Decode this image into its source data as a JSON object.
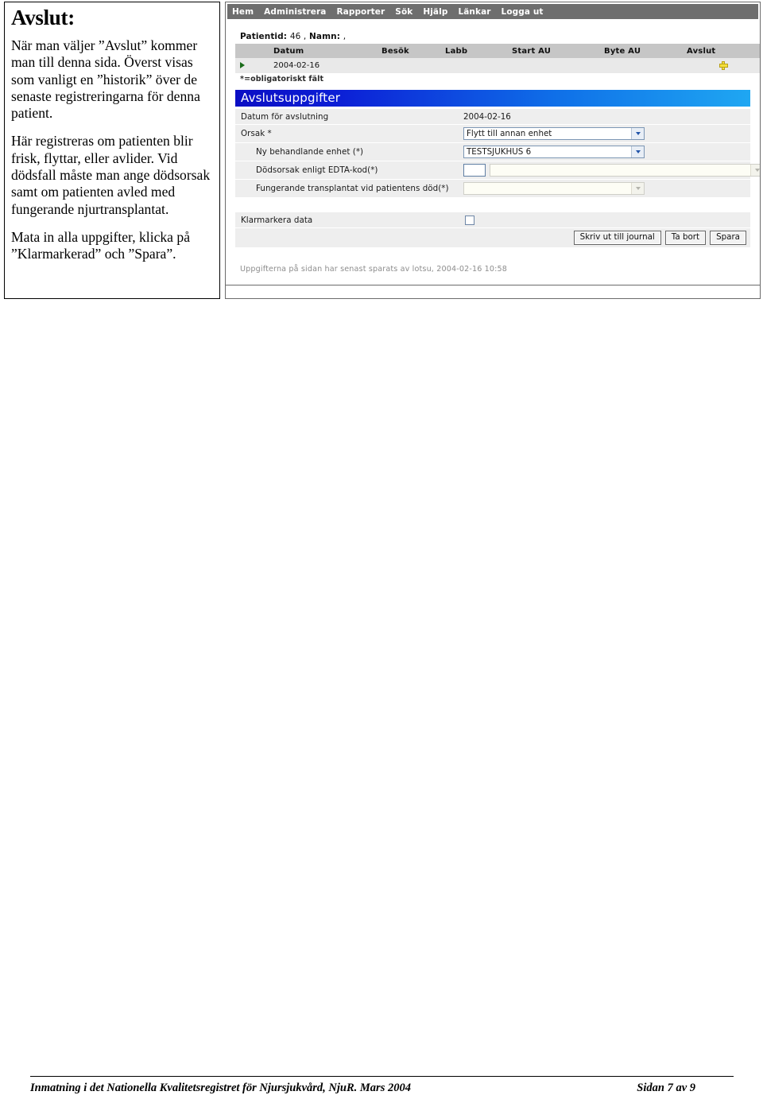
{
  "note": {
    "title": "Avslut:",
    "paragraphs": [
      "När man väljer ”Avslut” kommer man till denna sida. Överst visas som vanligt en ”historik” över de senaste registreringarna för denna patient.",
      "Här registreras om patienten blir frisk, flyttar, eller avlider.\nVid dödsfall måste man ange dödsorsak samt om patienten avled med fungerande njurtransplantat.",
      "Mata in alla uppgifter, klicka på ”Klarmarkerad” och ”Spara”."
    ],
    "para1": "När man väljer ”Avslut” kommer man till denna sida. Överst visas som vanligt en ”historik” över de senaste registreringarna för denna patient.",
    "para2": "Här registreras om patienten blir frisk, flyttar, eller avlider. Vid dödsfall måste man ange dödsorsak samt om patienten avled med fungerande njurtransplantat.",
    "para3": "Mata in alla uppgifter, klicka på ”Klarmarkerad” och ”Spara”."
  },
  "screenshot": {
    "menubar": {
      "items": [
        {
          "label": "Hem"
        },
        {
          "label": "Administrera"
        },
        {
          "label": "Rapporter"
        },
        {
          "label": "Sök"
        },
        {
          "label": "Hjälp"
        },
        {
          "label": "Länkar"
        },
        {
          "label": "Logga ut"
        }
      ]
    },
    "patient": {
      "id_label": "Patientid:",
      "id_value": "46 ,",
      "name_label": "Namn:",
      "name_value": ","
    },
    "history_table": {
      "headers": [
        "",
        "Datum",
        "Besök",
        "Labb",
        "Start AU",
        "Byte AU",
        "Avslut"
      ],
      "rows": [
        {
          "arrow": "selected-row-arrow",
          "datum": "2004-02-16",
          "besok": "",
          "labb": "",
          "start_au": "",
          "byte_au": "",
          "avslut_icon": "plus-icon"
        }
      ]
    },
    "obligatory_note": "*=obligatoriskt fält",
    "section_title": "Avslutsuppgifter",
    "form": {
      "rows": [
        {
          "label": "Datum för avslutning",
          "value": "2004-02-16",
          "type": "text"
        },
        {
          "label": "Orsak *",
          "value": "Flytt till annan enhet",
          "type": "select",
          "enabled": true
        },
        {
          "label": "Ny behandlande enhet (*)",
          "value": "TESTSJUKHUS 6",
          "type": "select",
          "enabled": true,
          "indent": true
        },
        {
          "label": "Dödsorsak enligt EDTA-kod(*)",
          "value": "",
          "type": "code-select",
          "enabled": false,
          "indent": true
        },
        {
          "label": "Fungerande transplantat vid patientens död(*)",
          "value": "",
          "type": "select",
          "enabled": false,
          "indent": true
        }
      ],
      "datum_label": "Datum för avslutning",
      "datum_value": "2004-02-16",
      "orsak_label": "Orsak *",
      "orsak_value": "Flytt till annan enhet",
      "enhet_label": "Ny behandlande enhet (*)",
      "enhet_value": "TESTSJUKHUS 6",
      "edta_label": "Dödsorsak enligt EDTA-kod(*)",
      "edta_code_value": "",
      "edta_value": "",
      "transplantat_label": "Fungerande transplantat vid patientens död(*)",
      "transplantat_value": "",
      "klarmarkera_label": "Klarmarkera data",
      "klarmarkera_checked": false
    },
    "buttons": {
      "print": "Skriv ut till journal",
      "delete": "Ta bort",
      "save": "Spara"
    },
    "saved_note": "Uppgifterna på sidan har senast sparats av lotsu, 2004-02-16 10:58",
    "colors": {
      "menubar_bg": "#6e6e6e",
      "table_header_bg": "#c6c6c6",
      "table_cell_bg": "#e9e9e9",
      "section_title_start": "#0b0ec4",
      "section_title_end": "#1fa7f2",
      "form_row_bg": "#eeeeee",
      "plus_icon": "#f5e03c",
      "arrow_green": "#1a6b1a"
    }
  },
  "footer": {
    "left": "Inmatning i det Nationella Kvalitetsregistret för Njursjukvård, NjuR.  Mars 2004",
    "right": "Sidan 7 av 9"
  }
}
